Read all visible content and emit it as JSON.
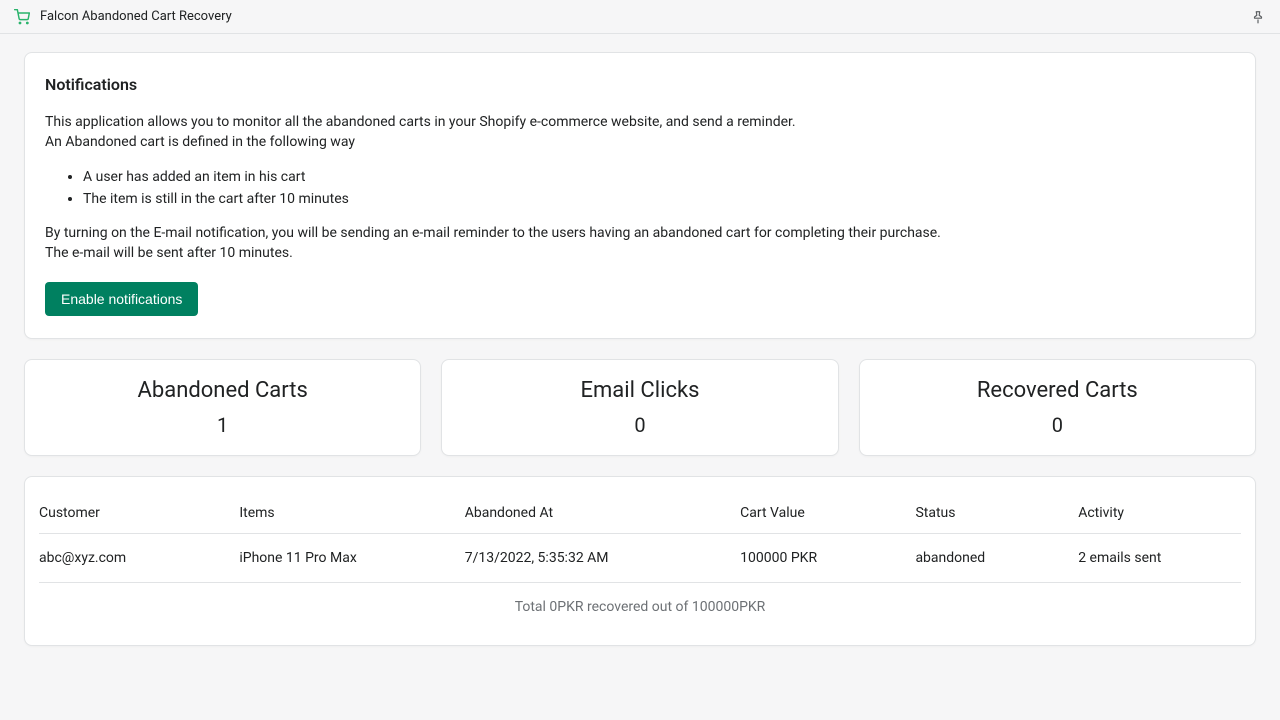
{
  "header": {
    "app_title": "Falcon Abandoned Cart Recovery"
  },
  "notifications": {
    "title": "Notifications",
    "intro_line1": "This application allows you to monitor all the abandoned carts in your Shopify e-commerce website, and send a reminder.",
    "intro_line2": "An Abandoned cart is defined in the following way",
    "bullets": [
      "A user has added an item in his cart",
      "The item is still in the cart after 10 minutes"
    ],
    "outro_line1": "By turning on the E-mail notification, you will be sending an e-mail reminder to the users having an abandoned cart for completing their purchase.",
    "outro_line2": "The e-mail will be sent after 10 minutes.",
    "enable_label": "Enable notifications"
  },
  "stats": [
    {
      "label": "Abandoned Carts",
      "value": "1"
    },
    {
      "label": "Email Clicks",
      "value": "0"
    },
    {
      "label": "Recovered Carts",
      "value": "0"
    }
  ],
  "table": {
    "columns": [
      "Customer",
      "Items",
      "Abandoned At",
      "Cart Value",
      "Status",
      "Activity"
    ],
    "rows": [
      {
        "customer": "abc@xyz.com",
        "items": "iPhone 11 Pro Max",
        "abandoned_at": "7/13/2022, 5:35:32 AM",
        "cart_value": "100000 PKR",
        "status": "abandoned",
        "activity": "2 emails sent"
      }
    ],
    "summary": "Total 0PKR recovered out of 100000PKR"
  }
}
